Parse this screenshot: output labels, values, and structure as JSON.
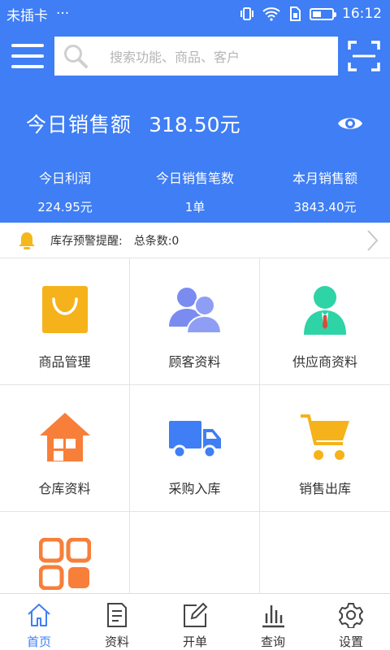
{
  "status_bar": {
    "carrier": "未插卡",
    "dots": "···",
    "time": "16:12"
  },
  "search": {
    "placeholder": "搜索功能、商品、客户"
  },
  "sales": {
    "title": "今日销售额",
    "amount": "318.50元",
    "stats": [
      {
        "label": "今日利润",
        "value": "224.95元"
      },
      {
        "label": "今日销售笔数",
        "value": "1单"
      },
      {
        "label": "本月销售额",
        "value": "3843.40元"
      }
    ]
  },
  "alert": {
    "label": "库存预警提醒:",
    "count": "总条数:0"
  },
  "grid": [
    {
      "label": "商品管理",
      "icon": "shopping-bag-icon"
    },
    {
      "label": "顾客资料",
      "icon": "customers-icon"
    },
    {
      "label": "供应商资料",
      "icon": "supplier-icon"
    },
    {
      "label": "仓库资料",
      "icon": "warehouse-icon"
    },
    {
      "label": "采购入库",
      "icon": "truck-icon"
    },
    {
      "label": "销售出库",
      "icon": "cart-icon"
    },
    {
      "label": "",
      "icon": "apps-icon"
    }
  ],
  "tabs": [
    {
      "label": "首页",
      "icon": "home-icon",
      "active": true
    },
    {
      "label": "资料",
      "icon": "document-icon"
    },
    {
      "label": "开单",
      "icon": "edit-icon"
    },
    {
      "label": "查询",
      "icon": "bar-chart-icon"
    },
    {
      "label": "设置",
      "icon": "settings-icon"
    }
  ],
  "colors": {
    "primary": "#3f7ef4",
    "orange": "#f5a623",
    "teal": "#2ed3a6",
    "purple": "#7b8cf0",
    "house": "#f77f3a"
  }
}
